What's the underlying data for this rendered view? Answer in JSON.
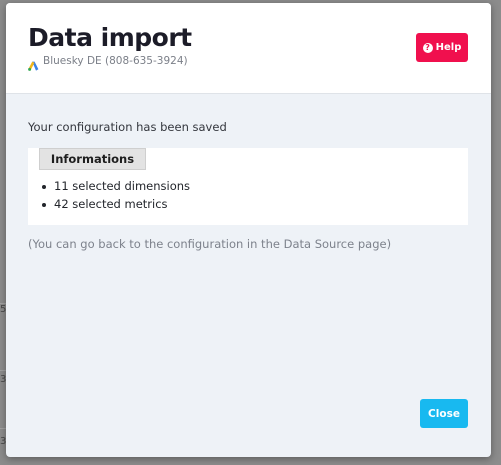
{
  "dialog": {
    "title": "Data import",
    "account_label": "Bluesky DE (808-635-3924)",
    "account_icon": "google-ads-icon",
    "help_label": "Help",
    "help_icon": "question-circle-icon",
    "saved_message": "Your configuration has been saved",
    "info_tab_label": "Informations",
    "info_items": [
      "11 selected dimensions",
      "42 selected metrics"
    ],
    "back_hint": "(You can go back to the configuration in the Data Source page)",
    "close_label": "Close"
  },
  "background": {
    "row_markers": [
      "5",
      "3",
      "3"
    ]
  },
  "colors": {
    "help_button": "#f0104e",
    "close_button": "#18b9f0",
    "modal_body": "#eef2f7",
    "title": "#1c1c28"
  }
}
